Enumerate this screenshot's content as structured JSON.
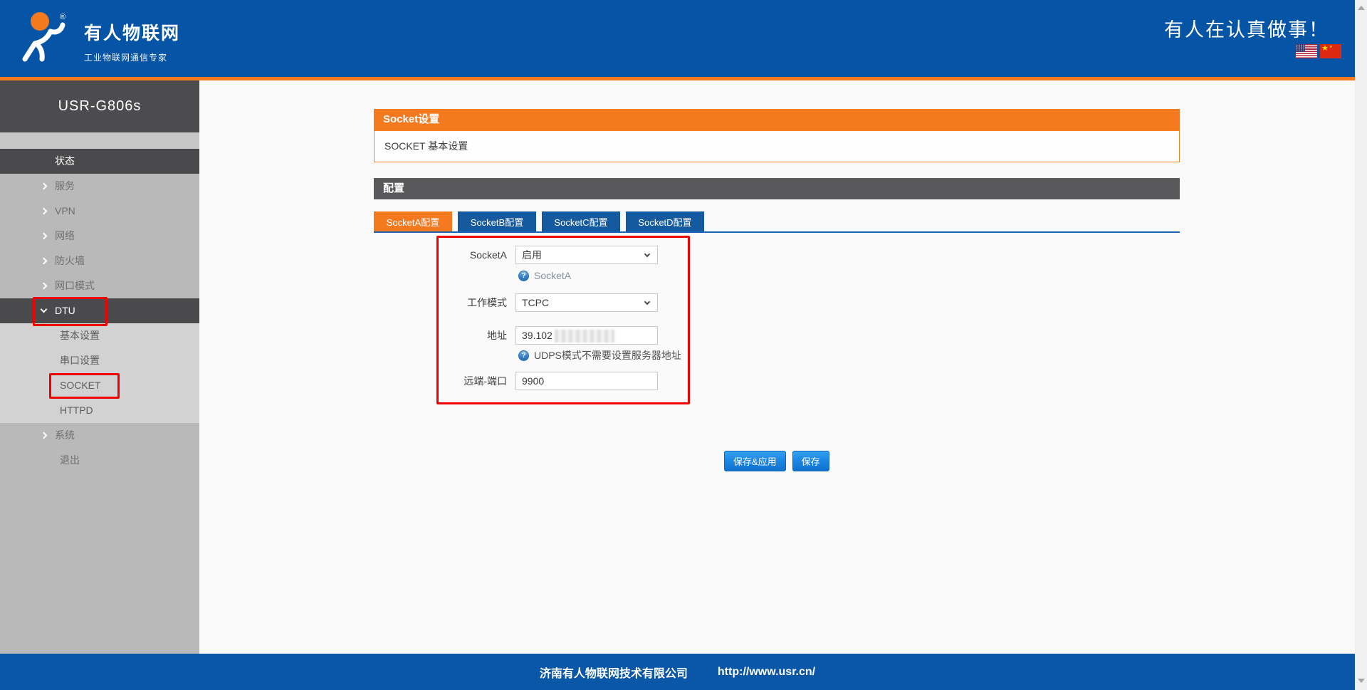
{
  "colors": {
    "brand_blue": "#0554a6",
    "accent_orange": "#f5791f",
    "tab_blue": "#15599e",
    "dark_bar": "#59595b",
    "annotation_red": "#f10000",
    "button_blue": "#1b85e2"
  },
  "icons": {
    "help": "?",
    "us_flag_star": "★",
    "cn_flag_star": "★",
    "registered": "®"
  },
  "header": {
    "brand_title": "有人物联网",
    "brand_slogan": "工业物联网通信专家",
    "slogan": "有人在认真做事！"
  },
  "sidebar": {
    "device": "USR-G806s",
    "items": [
      {
        "label": "状态"
      },
      {
        "label": "服务"
      },
      {
        "label": "VPN"
      },
      {
        "label": "网络"
      },
      {
        "label": "防火墙"
      },
      {
        "label": "网口模式"
      },
      {
        "label": "DTU"
      },
      {
        "label": "基本设置"
      },
      {
        "label": "串口设置"
      },
      {
        "label": "SOCKET"
      },
      {
        "label": "HTTPD"
      },
      {
        "label": "系统"
      },
      {
        "label": "退出"
      }
    ]
  },
  "main": {
    "panel_title": "Socket设置",
    "panel_subtitle": "SOCKET 基本设置",
    "section_title": "配置",
    "tabs": [
      {
        "label": "SocketA配置"
      },
      {
        "label": "SocketB配置"
      },
      {
        "label": "SocketC配置"
      },
      {
        "label": "SocketD配置"
      }
    ],
    "form": {
      "socketa_label": "SocketA",
      "socketa_value": "启用",
      "socketa_help": "SocketA",
      "workmode_label": "工作模式",
      "workmode_value": "TCPC",
      "address_label": "地址",
      "address_value": "39.102",
      "address_help": "UDPS模式不需要设置服务器地址",
      "port_label": "远端-端口",
      "port_value": "9900"
    },
    "buttons": {
      "save_apply": "保存&应用",
      "save": "保存"
    }
  },
  "footer": {
    "company": "济南有人物联网技术有限公司",
    "url": "http://www.usr.cn/"
  }
}
